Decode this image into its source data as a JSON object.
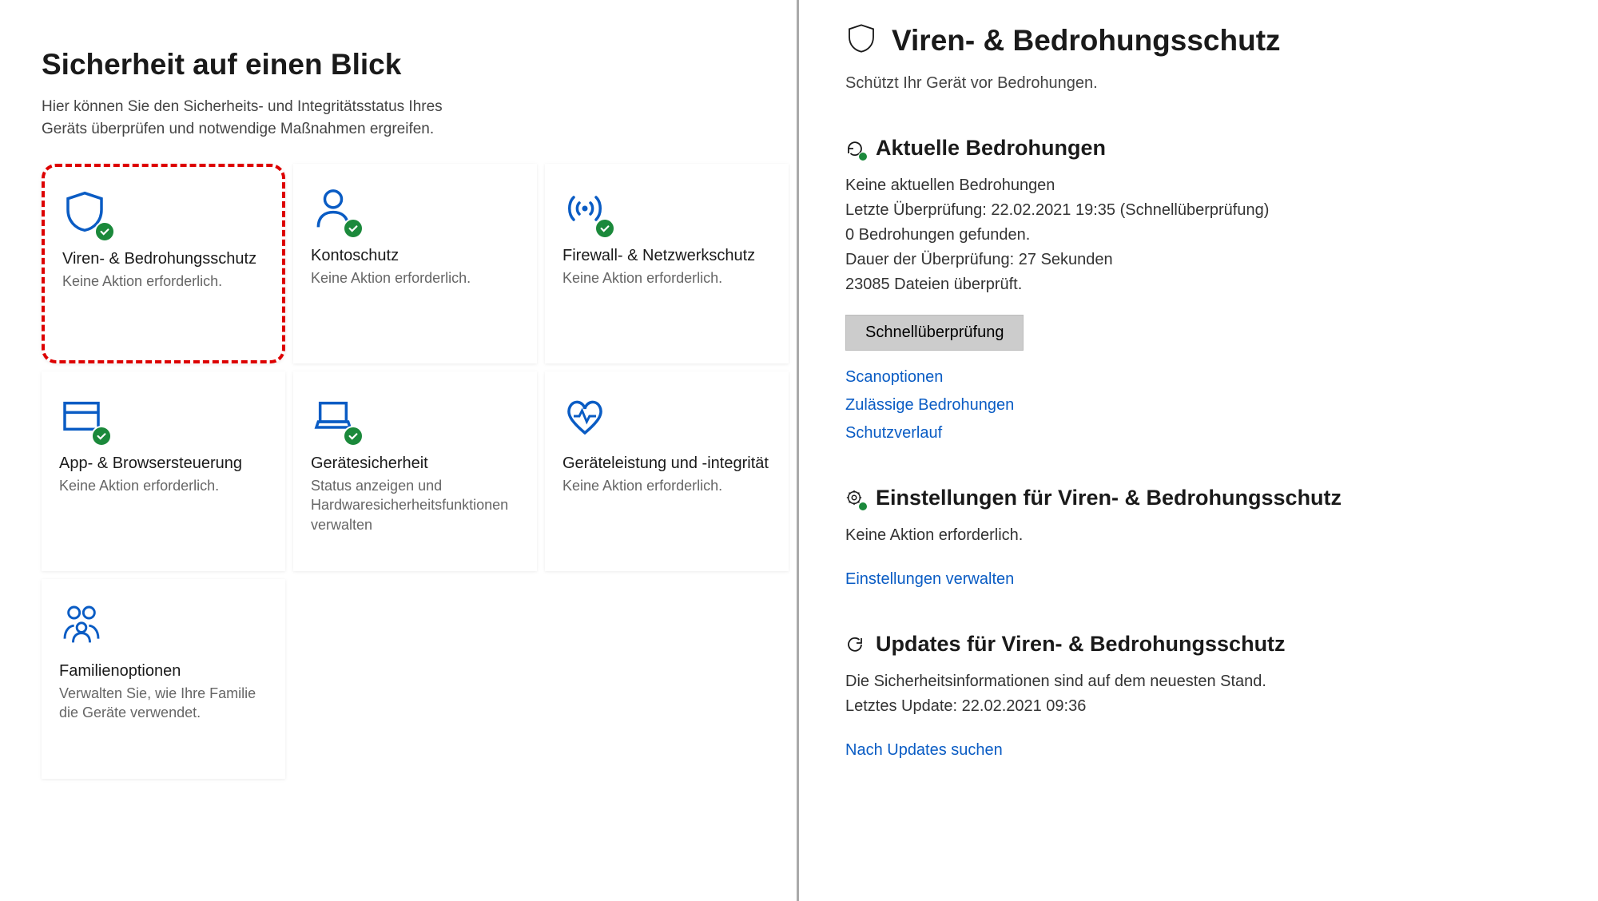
{
  "left": {
    "title": "Sicherheit auf einen Blick",
    "subtitle": "Hier können Sie den Sicherheits- und Integritätsstatus Ihres Geräts überprüfen und notwendige Maßnahmen ergreifen.",
    "tiles": [
      {
        "title": "Viren- & Bedrohungsschutz",
        "status": "Keine Aktion erforderlich."
      },
      {
        "title": "Kontoschutz",
        "status": "Keine Aktion erforderlich."
      },
      {
        "title": "Firewall- & Netzwerkschutz",
        "status": "Keine Aktion erforderlich."
      },
      {
        "title": "App- & Browsersteuerung",
        "status": "Keine Aktion erforderlich."
      },
      {
        "title": "Gerätesicherheit",
        "status": "Status anzeigen und Hardwaresicherheitsfunktionen verwalten"
      },
      {
        "title": "Geräteleistung und -integrität",
        "status": "Keine Aktion erforderlich."
      },
      {
        "title": "Familienoptionen",
        "status": "Verwalten Sie, wie Ihre Familie die Geräte verwendet."
      }
    ]
  },
  "right": {
    "title": "Viren- & Bedrohungsschutz",
    "subtitle": "Schützt Ihr Gerät vor Bedrohungen.",
    "threats": {
      "heading": "Aktuelle Bedrohungen",
      "line1": "Keine aktuellen Bedrohungen",
      "line2": "Letzte Überprüfung: 22.02.2021 19:35 (Schnellüberprüfung)",
      "line3": "0 Bedrohungen gefunden.",
      "line4": "Dauer der Überprüfung: 27 Sekunden",
      "line5": "23085 Dateien überprüft.",
      "button": "Schnellüberprüfung",
      "links": [
        "Scanoptionen",
        "Zulässige Bedrohungen",
        "Schutzverlauf"
      ]
    },
    "settings": {
      "heading": "Einstellungen für Viren- & Bedrohungsschutz",
      "status": "Keine Aktion erforderlich.",
      "link": "Einstellungen verwalten"
    },
    "updates": {
      "heading": "Updates für Viren- & Bedrohungsschutz",
      "line1": "Die Sicherheitsinformationen sind auf dem neuesten Stand.",
      "line2": "Letztes Update: 22.02.2021 09:36",
      "link": "Nach Updates suchen"
    }
  }
}
